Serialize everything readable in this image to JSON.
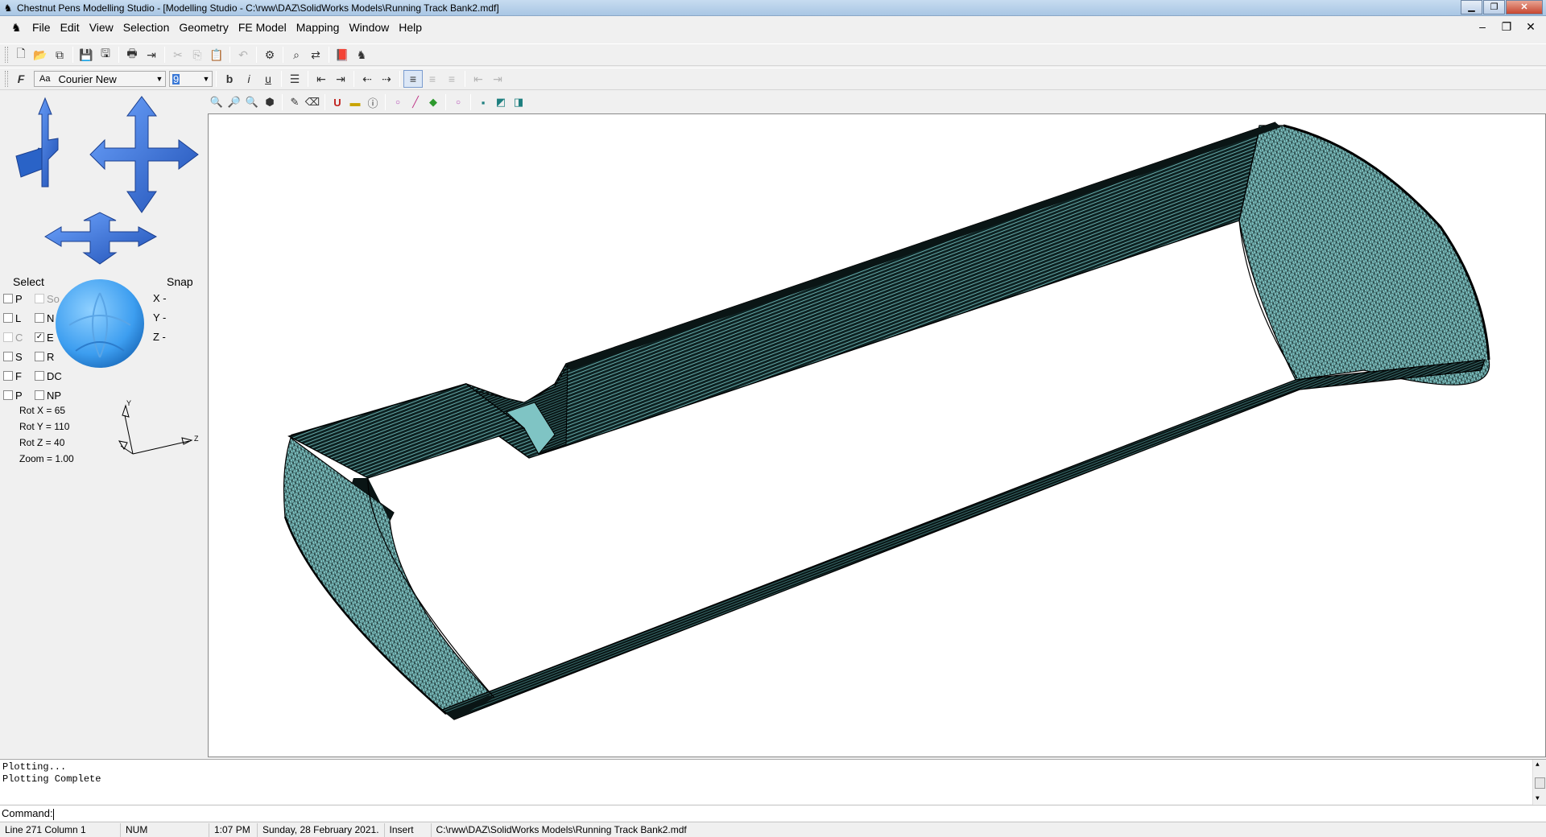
{
  "window": {
    "title": "Chestnut Pens Modelling Studio - [Modelling Studio - C:\\rww\\DAZ\\SolidWorks Models\\Running Track Bank2.mdf]",
    "controls": [
      "minimize",
      "maximize",
      "close"
    ]
  },
  "menu": {
    "items": [
      {
        "label": "File"
      },
      {
        "label": "Edit"
      },
      {
        "label": "View"
      },
      {
        "label": "Selection"
      },
      {
        "label": "Geometry"
      },
      {
        "label": "FE Model"
      },
      {
        "label": "Mapping"
      },
      {
        "label": "Window"
      },
      {
        "label": "Help"
      }
    ]
  },
  "format_bar": {
    "font_name": "Courier New",
    "font_size": "9",
    "font_icon": "Aa"
  },
  "select_panel": {
    "select_label": "Select",
    "snap_label": "Snap",
    "checkboxes": [
      {
        "left": {
          "label": "P",
          "checked": false
        },
        "right": {
          "label": "So",
          "checked": false,
          "disabled": true
        }
      },
      {
        "left": {
          "label": "L",
          "checked": false
        },
        "right": {
          "label": "N",
          "checked": false
        }
      },
      {
        "left": {
          "label": "C",
          "checked": false,
          "disabled": true
        },
        "right": {
          "label": "E",
          "checked": true
        }
      },
      {
        "left": {
          "label": "S",
          "checked": false
        },
        "right": {
          "label": "R",
          "checked": false
        }
      },
      {
        "left": {
          "label": "F",
          "checked": false
        },
        "right": {
          "label": "DC",
          "checked": false
        }
      },
      {
        "left": {
          "label": "P",
          "checked": false
        },
        "right": {
          "label": "NP",
          "checked": false
        }
      }
    ],
    "snap": [
      "X -",
      "Y -",
      "Z -"
    ],
    "rot_x": "Rot X = 65",
    "rot_y": "Rot Y = 110",
    "rot_z": "Rot Z = 40",
    "zoom": "Zoom = 1.00",
    "axis_y": "Y",
    "axis_z": "Z"
  },
  "output": {
    "lines": [
      "Plotting...",
      "Plotting Complete"
    ]
  },
  "command": {
    "label": "Command:",
    "value": ""
  },
  "status": {
    "position": "Line 271  Column 1",
    "num": "NUM",
    "time": "1:07 PM",
    "date": "Sunday, 28 February 2021.",
    "mode": "Insert",
    "file": "C:\\rww\\DAZ\\SolidWorks Models\\Running Track Bank2.mdf"
  },
  "colors": {
    "mesh_fill": "#7fc4c4",
    "mesh_edge": "#0b1a1a",
    "arrow_blue": "#2f6fd6",
    "sphere_blue": "#3d9ef0"
  }
}
